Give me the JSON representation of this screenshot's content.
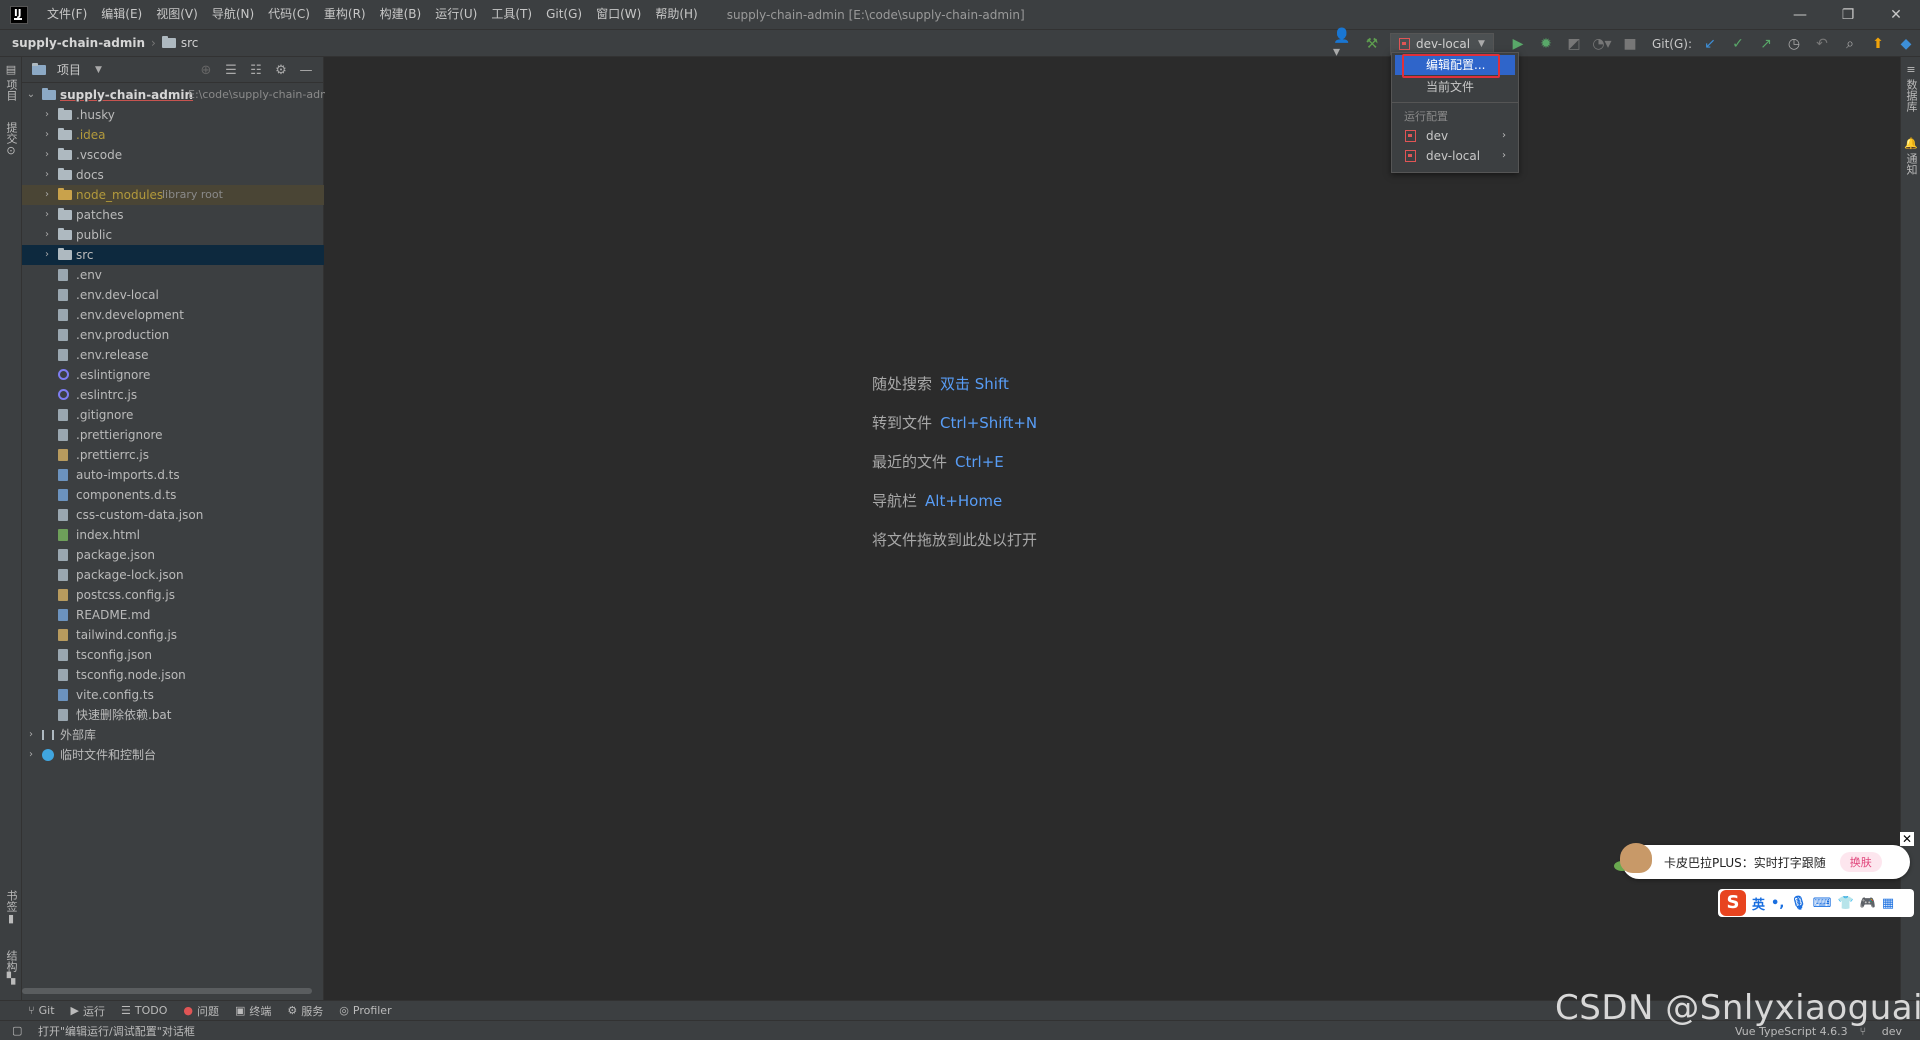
{
  "menubar": {
    "items": [
      "文件(F)",
      "编辑(E)",
      "视图(V)",
      "导航(N)",
      "代码(C)",
      "重构(R)",
      "构建(B)",
      "运行(U)",
      "工具(T)",
      "Git(G)",
      "窗口(W)",
      "帮助(H)"
    ],
    "window_title": "supply-chain-admin [E:\\code\\supply-chain-admin]",
    "logo_letter": "IJ"
  },
  "navbar": {
    "project": "supply-chain-admin",
    "folder": "src",
    "run_config": "dev-local",
    "git_label": "Git(G):"
  },
  "project_panel": {
    "title": "项目",
    "tree": [
      {
        "label": "supply-chain-admin",
        "suffix": "E:\\code\\supply-chain-admin",
        "kind": "root"
      },
      {
        "label": ".husky",
        "kind": "folder"
      },
      {
        "label": ".idea",
        "kind": "folder-gold"
      },
      {
        "label": ".vscode",
        "kind": "folder"
      },
      {
        "label": "docs",
        "kind": "folder"
      },
      {
        "label": "node_modules",
        "suffix": "library root",
        "kind": "lib-folder"
      },
      {
        "label": "patches",
        "kind": "folder"
      },
      {
        "label": "public",
        "kind": "folder"
      },
      {
        "label": "src",
        "kind": "folder-selected"
      },
      {
        "label": ".env",
        "kind": "file"
      },
      {
        "label": ".env.dev-local",
        "kind": "file"
      },
      {
        "label": ".env.development",
        "kind": "file"
      },
      {
        "label": ".env.production",
        "kind": "file"
      },
      {
        "label": ".env.release",
        "kind": "file"
      },
      {
        "label": ".eslintignore",
        "kind": "file-ring"
      },
      {
        "label": ".eslintrc.js",
        "kind": "file-ring"
      },
      {
        "label": ".gitignore",
        "kind": "file"
      },
      {
        "label": ".prettierignore",
        "kind": "file"
      },
      {
        "label": ".prettierrc.js",
        "kind": "file-tan"
      },
      {
        "label": "auto-imports.d.ts",
        "kind": "file-blue"
      },
      {
        "label": "components.d.ts",
        "kind": "file-blue"
      },
      {
        "label": "css-custom-data.json",
        "kind": "file"
      },
      {
        "label": "index.html",
        "kind": "file-green"
      },
      {
        "label": "package.json",
        "kind": "file"
      },
      {
        "label": "package-lock.json",
        "kind": "file"
      },
      {
        "label": "postcss.config.js",
        "kind": "file-tan"
      },
      {
        "label": "README.md",
        "kind": "file-blue"
      },
      {
        "label": "tailwind.config.js",
        "kind": "file-tan"
      },
      {
        "label": "tsconfig.json",
        "kind": "file"
      },
      {
        "label": "tsconfig.node.json",
        "kind": "file"
      },
      {
        "label": "vite.config.ts",
        "kind": "file-blue"
      },
      {
        "label": "快速删除依赖.bat",
        "kind": "file"
      },
      {
        "label": "外部库",
        "kind": "external"
      },
      {
        "label": "临时文件和控制台",
        "kind": "scratch"
      }
    ]
  },
  "left_strip": {
    "project_tab": "项目",
    "commit_tab": "提交",
    "bookmarks_tab": "书签",
    "structure_tab": "结构"
  },
  "right_strip": {
    "database_tab": "数据库",
    "notifications_tab": "通知"
  },
  "editor": {
    "hints": [
      {
        "text": "随处搜索",
        "key": "双击 Shift"
      },
      {
        "text": "转到文件",
        "key": "Ctrl+Shift+N"
      },
      {
        "text": "最近的文件",
        "key": "Ctrl+E"
      },
      {
        "text": "导航栏",
        "key": "Alt+Home"
      },
      {
        "text": "将文件拖放到此处以打开",
        "key": ""
      }
    ]
  },
  "popup": {
    "edit_config": "编辑配置...",
    "current_file": "当前文件",
    "section_header": "运行配置",
    "configs": [
      "dev",
      "dev-local"
    ]
  },
  "ime": {
    "card_text": "卡皮巴拉PLUS：实时打字跟随",
    "skin_button": "换肤",
    "lang": "英"
  },
  "tool_tabs": [
    {
      "label": "Git",
      "icon": "git-icon"
    },
    {
      "label": "运行",
      "icon": "run-icon"
    },
    {
      "label": "TODO",
      "icon": "todo-icon"
    },
    {
      "label": "问题",
      "icon": "problems-icon"
    },
    {
      "label": "终端",
      "icon": "terminal-icon"
    },
    {
      "label": "服务",
      "icon": "services-icon"
    },
    {
      "label": "Profiler",
      "icon": "profiler-icon"
    }
  ],
  "status": {
    "message": "打开\"编辑运行/调试配置\"对话框",
    "language": "Vue TypeScript 4.6.3",
    "branch": "dev"
  },
  "watermark": "CSDN @Snlyxiaoguais",
  "colors": {
    "accent": "#589df6",
    "selection": "#2f65ca",
    "highlight_box": "#e0303a"
  }
}
